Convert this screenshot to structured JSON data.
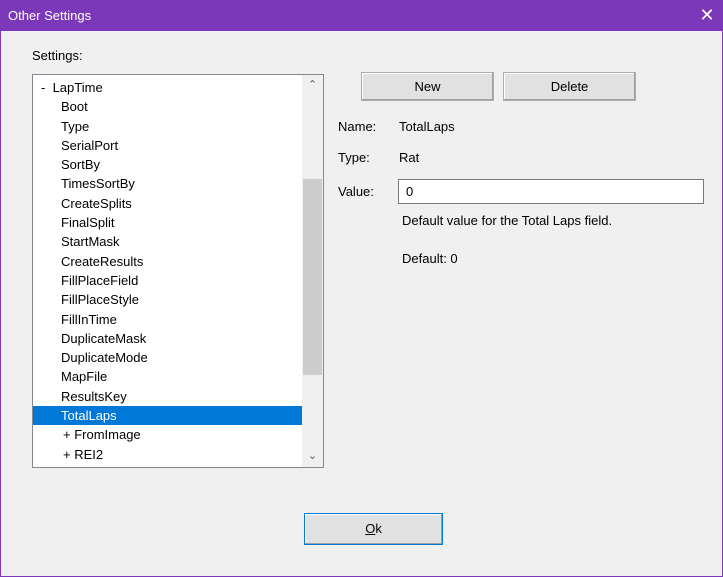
{
  "window": {
    "title": "Other Settings",
    "close_glyph": "✕",
    "accent_color": "#7b38b8"
  },
  "settings_label": "Settings:",
  "tree": {
    "root_prefix": "-",
    "root_label": "LapTime",
    "items": [
      "Boot",
      "Type",
      "SerialPort",
      "SortBy",
      "TimesSortBy",
      "CreateSplits",
      "FinalSplit",
      "StartMask",
      "CreateResults",
      "FillPlaceField",
      "FillPlaceStyle",
      "FillInTime",
      "DuplicateMask",
      "DuplicateMode",
      "MapFile",
      "ResultsKey",
      "TotalLaps"
    ],
    "selected": "TotalLaps",
    "collapsed_nodes": [
      "+ FromImage",
      "+ REI2"
    ],
    "selection_color": "#0078d7"
  },
  "buttons": {
    "new_label": "New",
    "delete_label": "Delete",
    "ok_label_accel": "O",
    "ok_label_rest": "k"
  },
  "detail": {
    "name_label": "Name:",
    "name_value": "TotalLaps",
    "type_label": "Type:",
    "type_value": "Rat",
    "value_label": "Value:",
    "value_input": "0",
    "description": "Default value for the Total Laps field.",
    "default_text": "Default: 0"
  }
}
